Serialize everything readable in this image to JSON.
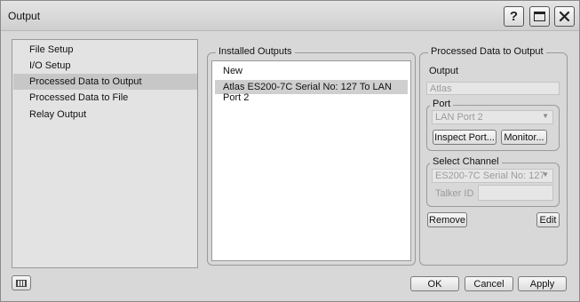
{
  "window": {
    "title": "Output"
  },
  "titlebar": {
    "help_label": "?"
  },
  "nav": {
    "items": [
      {
        "label": "File Setup",
        "selected": false
      },
      {
        "label": "I/O Setup",
        "selected": false
      },
      {
        "label": "Processed Data to Output",
        "selected": true
      },
      {
        "label": "Processed Data to File",
        "selected": false
      },
      {
        "label": "Relay Output",
        "selected": false
      }
    ]
  },
  "installed": {
    "legend": "Installed Outputs",
    "items": [
      {
        "label": "New",
        "selected": false
      },
      {
        "label": "Atlas ES200-7C Serial No: 127 To LAN Port 2",
        "selected": true
      }
    ]
  },
  "processed": {
    "legend": "Processed Data to Output",
    "output_label": "Output",
    "output_value": "Atlas",
    "port": {
      "legend": "Port",
      "selected": "LAN Port 2",
      "inspect_label": "Inspect Port...",
      "monitor_label": "Monitor..."
    },
    "channel": {
      "legend": "Select Channel",
      "selected": "ES200-7C Serial No: 127",
      "talker_label": "Talker ID",
      "talker_value": ""
    },
    "remove_label": "Remove",
    "edit_label": "Edit"
  },
  "footer": {
    "ok_label": "OK",
    "cancel_label": "Cancel",
    "apply_label": "Apply"
  },
  "icons": {
    "help": "help-icon",
    "maximize": "maximize-icon",
    "close": "close-icon",
    "keyboard": "keyboard-icon"
  }
}
